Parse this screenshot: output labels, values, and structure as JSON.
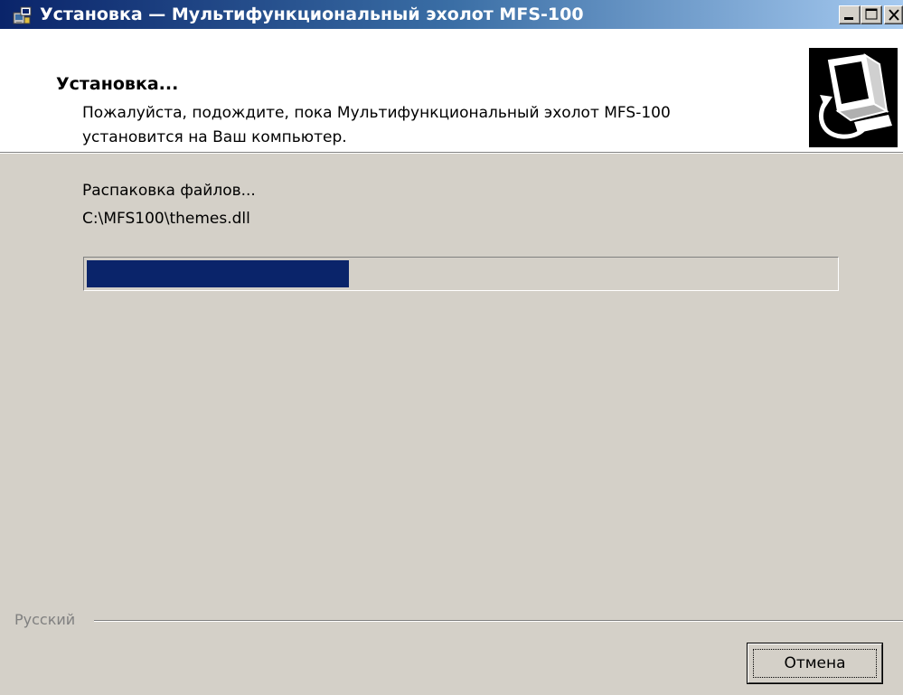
{
  "window": {
    "title": "Установка — Мультифункциональный эхолот MFS-100",
    "title_bar_color": "#0a246a"
  },
  "header": {
    "title": "Установка...",
    "description_line1": "Пожалуйста, подождите, пока Мультифункциональный эхолот MFS-100",
    "description_line2": "установится на Ваш компьютер.",
    "logo_icon": "computer-install-icon"
  },
  "status": {
    "text": "Распаковка файлов...",
    "filename": "C:\\MFS100\\themes.dll",
    "progress_percent": 35,
    "progress_color": "#0a246a"
  },
  "footer": {
    "language": "Русский",
    "cancel_label": "Отмена"
  }
}
